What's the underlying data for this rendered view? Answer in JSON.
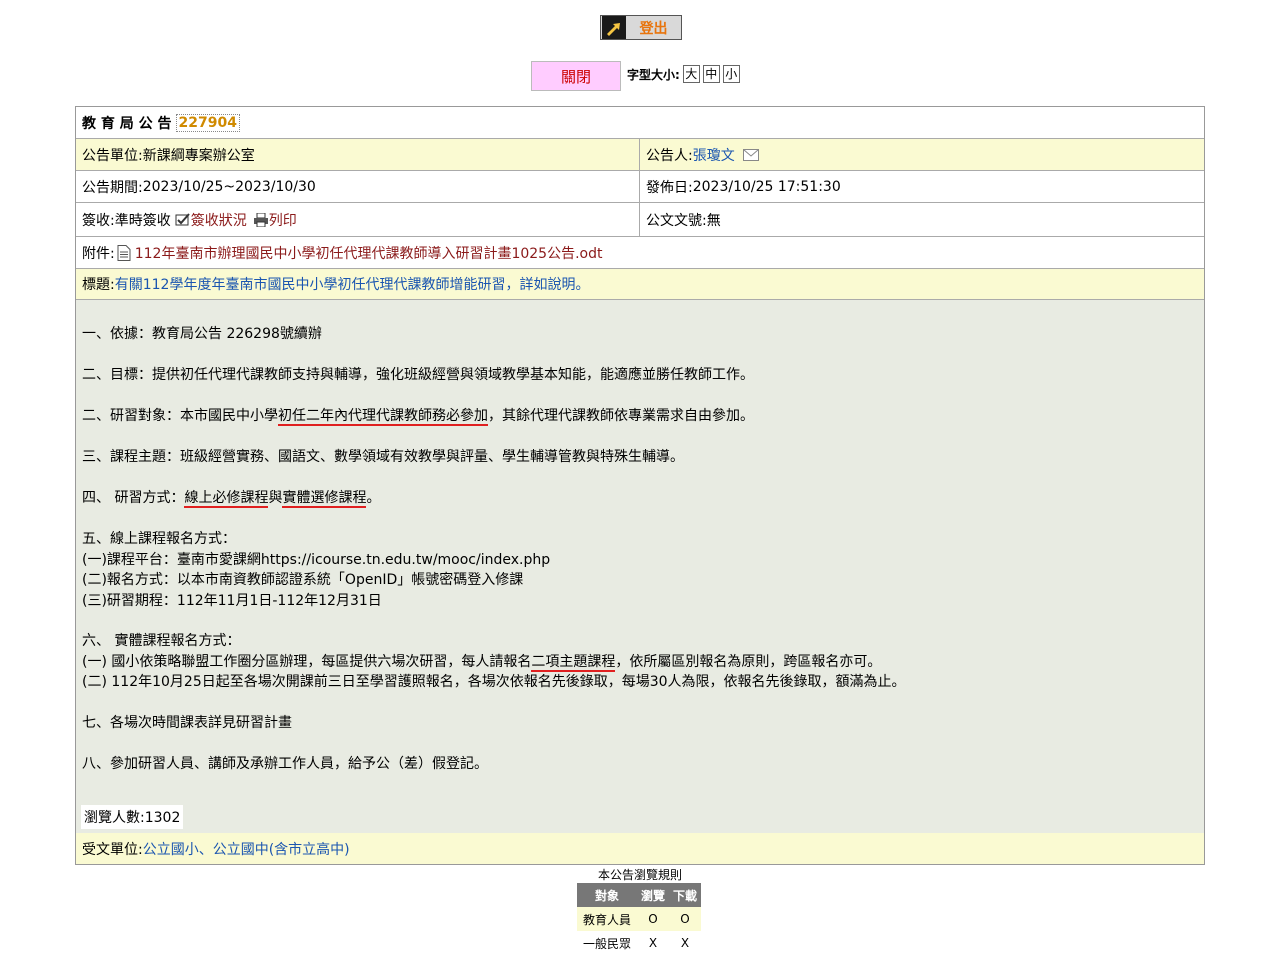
{
  "header": {
    "logout_label": "登出",
    "close_label": "關閉",
    "font_size_label": "字型大小:",
    "font_sizes": [
      "大",
      "中",
      "小"
    ]
  },
  "announcement": {
    "title": "教 育 局 公 告",
    "id": "227904",
    "unit_label": "公告單位:",
    "unit": "新課綱專案辦公室",
    "announcer_label": "公告人:",
    "announcer": "張瓊文",
    "period_label": "公告期間:",
    "period": "2023/10/25~2023/10/30",
    "publish_label": "發佈日:",
    "publish_date": "2023/10/25 17:51:30",
    "sign_label": "簽收:",
    "sign_value": "準時簽收",
    "sign_status_link": "簽收狀況",
    "print_link": "列印",
    "doc_no_label": "公文文號:",
    "doc_no": "無",
    "attachment_label": "附件:",
    "attachment": "112年臺南市辦理國民中小學初任代理代課教師導入研習計畫1025公告.odt",
    "subject_label": "標題:",
    "subject": "有關112學年度年臺南市國民中小學初任代理代課教師增能研習，詳如說明。",
    "body": {
      "l1": "一、依據：教育局公告 226298號續辦",
      "l2": "二、目標：提供初任代理代課教師支持與輔導，強化班級經營與領域教學基本知能，能適應並勝任教師工作。",
      "l3a": "二、研習對象：本市國民中小學",
      "l3b": "初任二年內代理代課教師務必參加",
      "l3c": "，其餘代理代課教師依專業需求自由參加。",
      "l4": "三、課程主題：班級經營實務、國語文、數學領域有效教學與評量、學生輔導管教與特殊生輔導。",
      "l5a": "四、 研習方式：",
      "l5b": "線上必修課程",
      "l5c": "與",
      "l5d": "實體選修課程",
      "l5e": "。",
      "l6": "五、線上課程報名方式：",
      "l7": "(一)課程平台：臺南市愛課網https://icourse.tn.edu.tw/mooc/index.php",
      "l8": "(二)報名方式：以本市南資教師認證系統「OpenID」帳號密碼登入修課",
      "l9": "(三)研習期程：112年11月1日-112年12月31日",
      "l10": "六、 實體課程報名方式：",
      "l11a": "(一) 國小依策略聯盟工作圈分區辦理，每區提供六場次研習，每人請報名",
      "l11b": "二項主題課程",
      "l11c": "，依所屬區別報名為原則，跨區報名亦可。",
      "l12": "(二) 112年10月25日起至各場次開課前三日至學習護照報名，各場次依報名先後錄取，每場30人為限，依報名先後錄取，額滿為止。",
      "l13": "七、各場次時間課表詳見研習計畫",
      "l14": "八、參加研習人員、講師及承辦工作人員，給予公（差）假登記。"
    },
    "views": "瀏覽人數:1302",
    "recipients_label": "受文單位:",
    "recipients": "公立國小、公立國中(含市立高中)"
  },
  "rules": {
    "caption": "本公告瀏覽規則",
    "headers": [
      "對象",
      "瀏覽",
      "下載"
    ],
    "rows": [
      [
        "教育人員",
        "O",
        "O"
      ],
      [
        "一般民眾",
        "X",
        "X"
      ]
    ]
  }
}
